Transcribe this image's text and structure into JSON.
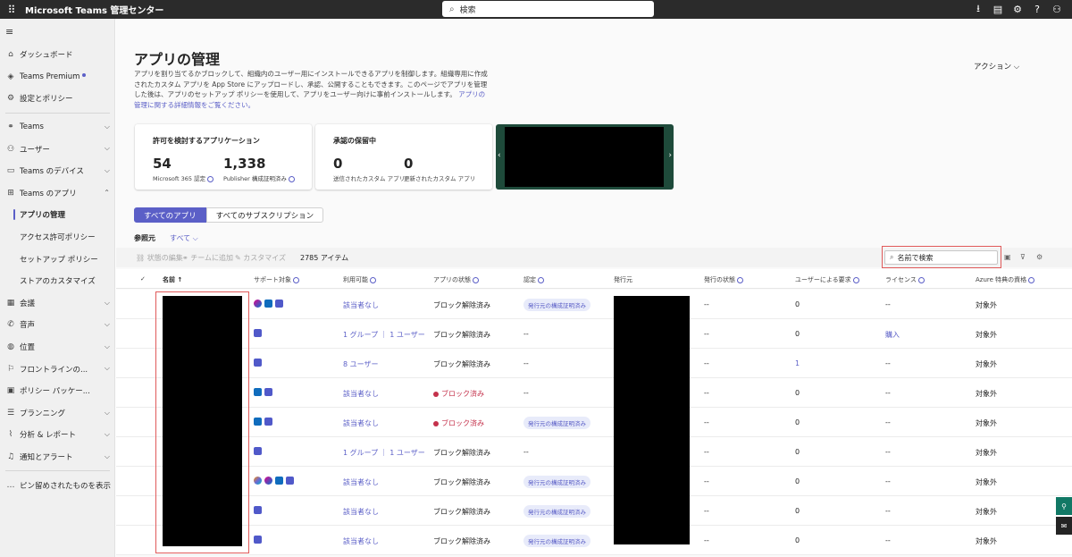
{
  "topbar": {
    "app_title": "Microsoft Teams 管理センター",
    "search_placeholder": "検索",
    "icons": [
      "download-icon",
      "screen-icon",
      "gear-icon",
      "help-icon",
      "account-icon"
    ]
  },
  "sidebar": {
    "items": [
      {
        "label": "ダッシュボード",
        "icon": "home-icon"
      },
      {
        "label": "Teams Premium",
        "icon": "premium-icon"
      },
      {
        "label": "設定とポリシー",
        "icon": "settings-icon"
      },
      {
        "label": "Teams",
        "icon": "teams-icon"
      },
      {
        "label": "ユーザー",
        "icon": "users-icon"
      },
      {
        "label": "Teams のデバイス",
        "icon": "device-icon"
      },
      {
        "label": "Teams のアプリ",
        "icon": "apps-icon"
      },
      {
        "label": "アプリの管理"
      },
      {
        "label": "アクセス許可ポリシー"
      },
      {
        "label": "セットアップ ポリシー"
      },
      {
        "label": "ストアのカスタマイズ"
      },
      {
        "label": "会議",
        "icon": "calendar-icon"
      },
      {
        "label": "音声",
        "icon": "phone-icon"
      },
      {
        "label": "位置",
        "icon": "globe-icon"
      },
      {
        "label": "フロントラインの...",
        "icon": "frontline-icon"
      },
      {
        "label": "ポリシー パッケー...",
        "icon": "package-icon"
      },
      {
        "label": "プランニング",
        "icon": "planning-icon"
      },
      {
        "label": "分析 & レポート",
        "icon": "analytics-icon"
      },
      {
        "label": "通知とアラート",
        "icon": "bell-icon"
      },
      {
        "label": "ピン留めされたものを表示",
        "icon": "more-icon"
      }
    ]
  },
  "main": {
    "title": "アプリの管理",
    "description": "アプリを割り当てるかブロックして、組織内のユーザー用にインストールできるアプリを制御します。組織専用に作成されたカスタム アプリを App Store にアップロードし、承認、公開することもできます。このページでアプリを管理した後は、アプリのセットアップ ポリシーを使用して、アプリをユーザー向けに事前インストールします。",
    "description_link": "アプリの管理に関する詳細情報をご覧ください。",
    "actions_label": "アクション",
    "card1": {
      "title": "許可を検討するアプリケーション",
      "stat1_value": "54",
      "stat1_label": "Microsoft 365 認定",
      "stat2_value": "1,338",
      "stat2_label": "Publisher 構成証明済み"
    },
    "card2": {
      "title": "承認の保留中",
      "stat1_value": "0",
      "stat1_label": "送信されたカスタム アプリ",
      "stat2_value": "0",
      "stat2_label": "更新されたカスタム アプリ"
    },
    "tabs": [
      "すべてのアプリ",
      "すべてのサブスクリプション"
    ],
    "ref_label": "参照元",
    "ref_value": "すべて",
    "toolbar": {
      "edit_status": "状態の編集",
      "add_to_team": "チームに追加",
      "customize": "カスタマイズ",
      "count": "2785 アイテム",
      "search_placeholder": "名前で検索"
    },
    "columns": [
      "名前 ↑",
      "サポート対象",
      "利用可能",
      "アプリの状態",
      "認定",
      "発行元",
      "発行の状態",
      "ユーザーによる要求",
      "ライセンス",
      "Azure 特典の資格"
    ]
  },
  "rows": [
    {
      "icons": [
        "m365",
        "outlook",
        "teams"
      ],
      "avail": "該当者なし",
      "avail_link": true,
      "state": "ブロック解除済み",
      "blocked": false,
      "cert": "発行元の構成証明済み",
      "pubstate": "--",
      "requests": "0",
      "requests_link": false,
      "license": "--",
      "license_link": false,
      "azure": "対象外"
    },
    {
      "icons": [
        "teams"
      ],
      "avail": "1 グループ ｜ 1 ユーザー",
      "avail_link": true,
      "state": "ブロック解除済み",
      "blocked": false,
      "cert": "--",
      "pubstate": "--",
      "requests": "0",
      "requests_link": false,
      "license": "購入",
      "license_link": true,
      "azure": "対象外"
    },
    {
      "icons": [
        "teams"
      ],
      "avail": "8 ユーザー",
      "avail_link": true,
      "state": "ブロック解除済み",
      "blocked": false,
      "cert": "--",
      "pubstate": "--",
      "requests": "1",
      "requests_link": true,
      "license": "--",
      "license_link": false,
      "azure": "対象外"
    },
    {
      "icons": [
        "outlook",
        "teams"
      ],
      "avail": "該当者なし",
      "avail_link": true,
      "state": "ブロック済み",
      "blocked": true,
      "cert": "--",
      "pubstate": "--",
      "requests": "0",
      "requests_link": false,
      "license": "--",
      "license_link": false,
      "azure": "対象外"
    },
    {
      "icons": [
        "outlook",
        "teams"
      ],
      "avail": "該当者なし",
      "avail_link": true,
      "state": "ブロック済み",
      "blocked": true,
      "cert": "発行元の構成証明済み",
      "pubstate": "--",
      "requests": "0",
      "requests_link": false,
      "license": "--",
      "license_link": false,
      "azure": "対象外"
    },
    {
      "icons": [
        "teams"
      ],
      "avail": "1 グループ ｜ 1 ユーザー",
      "avail_link": true,
      "state": "ブロック解除済み",
      "blocked": false,
      "cert": "--",
      "pubstate": "--",
      "requests": "0",
      "requests_link": false,
      "license": "--",
      "license_link": false,
      "azure": "対象外"
    },
    {
      "icons": [
        "copilot",
        "m365",
        "outlook",
        "teams"
      ],
      "avail": "該当者なし",
      "avail_link": true,
      "state": "ブロック解除済み",
      "blocked": false,
      "cert": "発行元の構成証明済み",
      "pubstate": "--",
      "requests": "0",
      "requests_link": false,
      "license": "--",
      "license_link": false,
      "azure": "対象外"
    },
    {
      "icons": [
        "teams"
      ],
      "avail": "該当者なし",
      "avail_link": true,
      "state": "ブロック解除済み",
      "blocked": false,
      "cert": "発行元の構成証明済み",
      "pubstate": "--",
      "requests": "0",
      "requests_link": false,
      "license": "--",
      "license_link": false,
      "azure": "対象外"
    },
    {
      "icons": [
        "teams"
      ],
      "avail": "該当者なし",
      "avail_link": true,
      "state": "ブロック解除済み",
      "blocked": false,
      "cert": "発行元の構成証明済み",
      "pubstate": "--",
      "requests": "0",
      "requests_link": false,
      "license": "--",
      "license_link": false,
      "azure": "対象外"
    }
  ],
  "colors": {
    "accent": "#5b5fc7",
    "blocked": "#c4314b",
    "topbar": "#2b2b2b",
    "sidetab": "#117865"
  }
}
